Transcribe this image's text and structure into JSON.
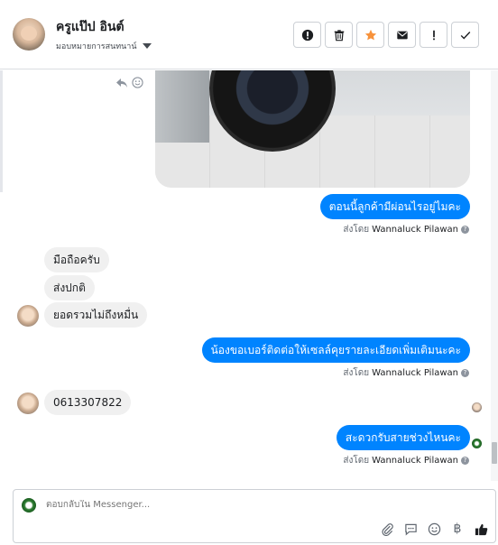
{
  "header": {
    "contact_name": "ครูแป๊ป อินต์",
    "assign_label": "มอบหมายการสนทนาน์",
    "actions": [
      {
        "icon": "alert-circle-icon",
        "name": "mark-spam-button"
      },
      {
        "icon": "trash-icon",
        "name": "delete-button"
      },
      {
        "icon": "star-icon",
        "name": "star-button"
      },
      {
        "icon": "envelope-icon",
        "name": "mark-unread-button"
      },
      {
        "icon": "exclamation-icon",
        "name": "mark-important-button"
      },
      {
        "icon": "check-icon",
        "name": "mark-done-button"
      }
    ],
    "star_color": "#f7923b"
  },
  "thread": {
    "messages": [
      {
        "from": "page",
        "text": "ตอนนี้ลูกค้ามีผ่อนไรอยู่ไมคะ",
        "sent_by_label": "ส่งโดย",
        "sent_by_name": "Wannaluck Pilawan"
      },
      {
        "from": "customer",
        "text": "มือถือครับ"
      },
      {
        "from": "customer",
        "text": "ส่งปกติ"
      },
      {
        "from": "customer",
        "text": "ยอดรวมไม่ถึงหมื่น"
      },
      {
        "from": "page",
        "text": "น้องขอเบอร์ติดต่อให้เซลล์คุยรายละเอียดเพิ่มเติมนะคะ",
        "sent_by_label": "ส่งโดย",
        "sent_by_name": "Wannaluck Pilawan"
      },
      {
        "from": "customer",
        "text": "0613307822"
      },
      {
        "from": "page",
        "text": "สะดวกรับสายช่วงไหนคะ",
        "sent_by_label": "ส่งโดย",
        "sent_by_name": "Wannaluck Pilawan"
      }
    ],
    "help_mark": "?",
    "out_color": "#0084ff",
    "in_color": "#f0f0f0"
  },
  "composer": {
    "placeholder": "ตอบกลับใน Messenger...",
    "tools": [
      "paperclip-icon",
      "chat-bubble-icon",
      "emoji-icon",
      "baht-icon",
      "thumbs-up-icon"
    ],
    "baht_symbol": "฿"
  }
}
